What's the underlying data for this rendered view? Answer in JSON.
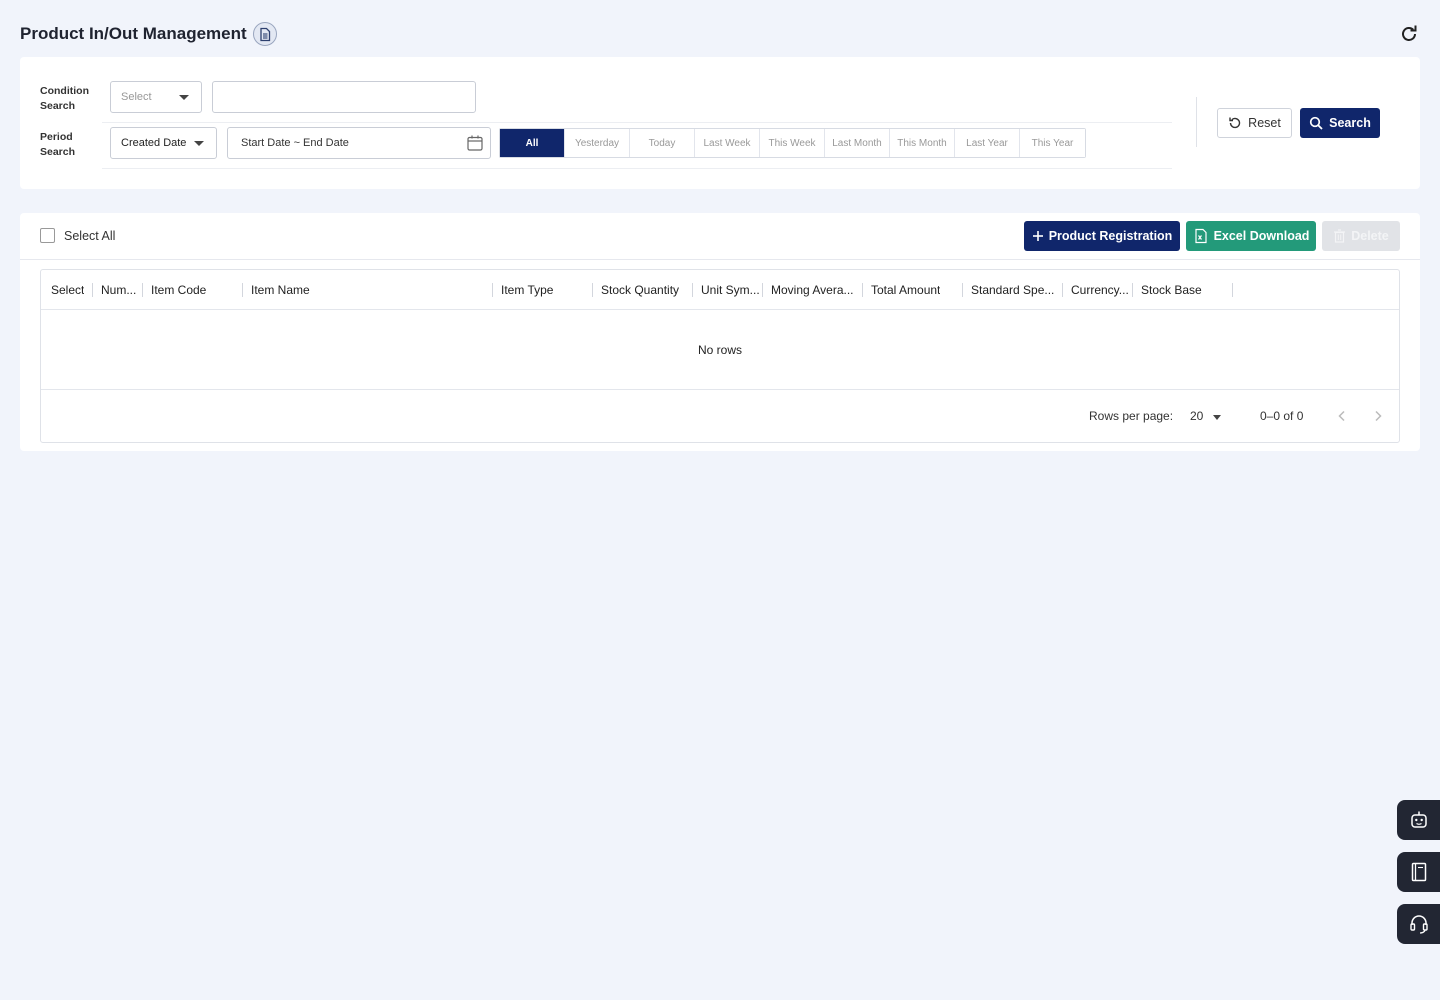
{
  "header": {
    "title": "Product In/Out Management",
    "doc_icon": "document-icon",
    "refresh_icon": "refresh-icon"
  },
  "search": {
    "condition_label_line1": "Condition",
    "condition_label_line2": "Search",
    "condition_select_placeholder": "Select",
    "condition_input_value": "",
    "period_label_line1": "Period",
    "period_label_line2": "Search",
    "period_select_value": "Created Date",
    "date_range_placeholder": "Start Date ~ End Date",
    "period_buttons": [
      "All",
      "Yesterday",
      "Today",
      "Last Week",
      "This Week",
      "Last Month",
      "This Month",
      "Last Year",
      "This Year"
    ],
    "active_period": "All",
    "reset_label": "Reset",
    "search_label": "Search"
  },
  "toolbar": {
    "select_all_label": "Select All",
    "register_label": "Product Registration",
    "excel_label": "Excel Download",
    "delete_label": "Delete"
  },
  "table": {
    "columns": [
      "Select",
      "Num...",
      "Item Code",
      "Item Name",
      "Item Type",
      "Stock Quantity",
      "Unit Sym...",
      "Moving Avera...",
      "Total Amount",
      "Standard Spe...",
      "Currency...",
      "Stock Base"
    ],
    "empty_text": "No rows",
    "rows_per_page_label": "Rows per page:",
    "rows_per_page_value": "20",
    "page_info": "0–0 of 0"
  },
  "colors": {
    "primary": "#10266b",
    "excel": "#239a7a",
    "disabled": "#e1e3e7",
    "background": "#f1f4fb"
  },
  "side_buttons": [
    "chatbot-icon",
    "manual-book-icon",
    "support-headset-icon"
  ]
}
